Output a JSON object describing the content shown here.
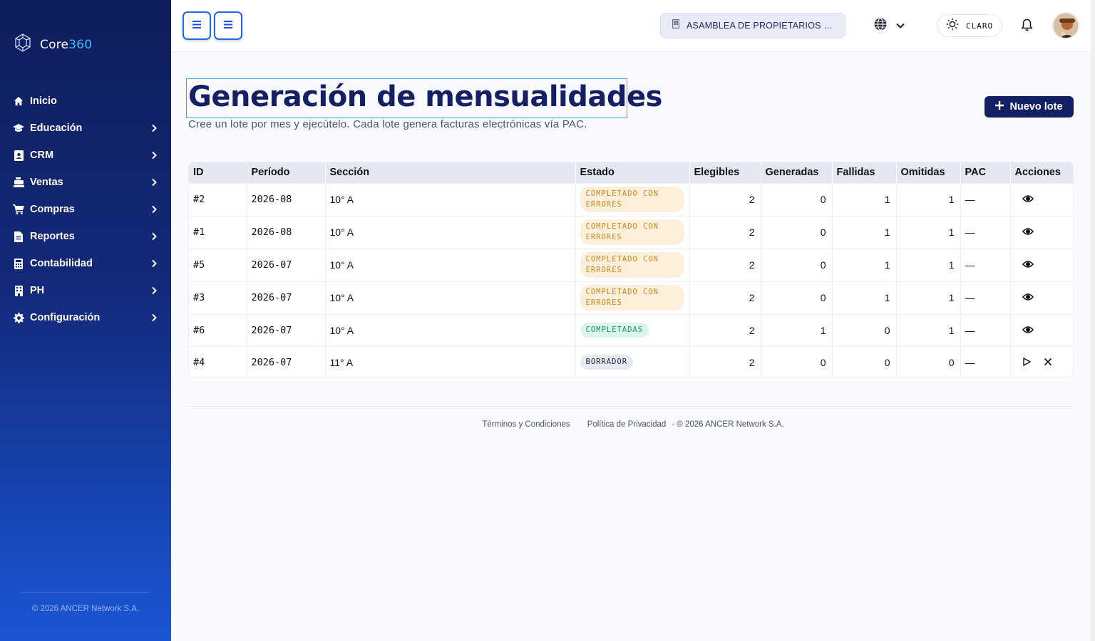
{
  "brand": {
    "name_prefix": "Core",
    "name_suffix": "360"
  },
  "sidebar": {
    "items": [
      {
        "label": "Inicio",
        "icon": "home-icon"
      },
      {
        "label": "Educación",
        "icon": "graduation-cap-icon"
      },
      {
        "label": "CRM",
        "icon": "contact-card-icon"
      },
      {
        "label": "Ventas",
        "icon": "cash-register-icon"
      },
      {
        "label": "Compras",
        "icon": "cart-icon"
      },
      {
        "label": "Reportes",
        "icon": "file-report-icon"
      },
      {
        "label": "Contabilidad",
        "icon": "calculator-icon"
      },
      {
        "label": "PH",
        "icon": "building-icon"
      },
      {
        "label": "Configuración",
        "icon": "gear-icon"
      }
    ],
    "footer": "© 2026 ANCER Network S.A."
  },
  "topbar": {
    "org": "ASAMBLEA DE PROPIETARIOS DE …",
    "theme": "CLARO"
  },
  "page": {
    "title": "Generación de mensualidades",
    "subtitle": "Cree un lote por mes y ejecútelo. Cada lote genera facturas electrónicas vía PAC.",
    "new_button": "Nuevo lote"
  },
  "table": {
    "columns": [
      "ID",
      "Período",
      "Sección",
      "Estado",
      "Elegibles",
      "Generadas",
      "Fallidas",
      "Omitidas",
      "PAC",
      "Acciones"
    ],
    "rows": [
      {
        "id": "#2",
        "period": "2026-08",
        "section": "10° A",
        "status": "COMPLETADO CON ERRORES",
        "status_kind": "err",
        "eligible": "2",
        "generated": "0",
        "failed": "1",
        "omitted": "1",
        "pac": "—",
        "actions": [
          "view"
        ]
      },
      {
        "id": "#1",
        "period": "2026-08",
        "section": "10° A",
        "status": "COMPLETADO CON ERRORES",
        "status_kind": "err",
        "eligible": "2",
        "generated": "0",
        "failed": "1",
        "omitted": "1",
        "pac": "—",
        "actions": [
          "view"
        ]
      },
      {
        "id": "#5",
        "period": "2026-07",
        "section": "10° A",
        "status": "COMPLETADO CON ERRORES",
        "status_kind": "err",
        "eligible": "2",
        "generated": "0",
        "failed": "1",
        "omitted": "1",
        "pac": "—",
        "actions": [
          "view"
        ]
      },
      {
        "id": "#3",
        "period": "2026-07",
        "section": "10° A",
        "status": "COMPLETADO CON ERRORES",
        "status_kind": "err",
        "eligible": "2",
        "generated": "0",
        "failed": "1",
        "omitted": "1",
        "pac": "—",
        "actions": [
          "view"
        ]
      },
      {
        "id": "#6",
        "period": "2026-07",
        "section": "10° A",
        "status": "COMPLETADAS",
        "status_kind": "ok",
        "eligible": "2",
        "generated": "1",
        "failed": "0",
        "omitted": "1",
        "pac": "—",
        "actions": [
          "view"
        ]
      },
      {
        "id": "#4",
        "period": "2026-07",
        "section": "11° A",
        "status": "BORRADOR",
        "status_kind": "draft",
        "eligible": "2",
        "generated": "0",
        "failed": "0",
        "omitted": "0",
        "pac": "—",
        "actions": [
          "run",
          "cancel"
        ]
      }
    ]
  },
  "footer": {
    "terms": "Términos y Condiciones",
    "privacy": "Política de Privacidad",
    "copyright": "· © 2026 ANCER Network S.A."
  },
  "colors": {
    "primary": "#142066",
    "accent": "#2563eb",
    "error_badge": "#d48a16",
    "ok_badge": "#1a9a63"
  }
}
